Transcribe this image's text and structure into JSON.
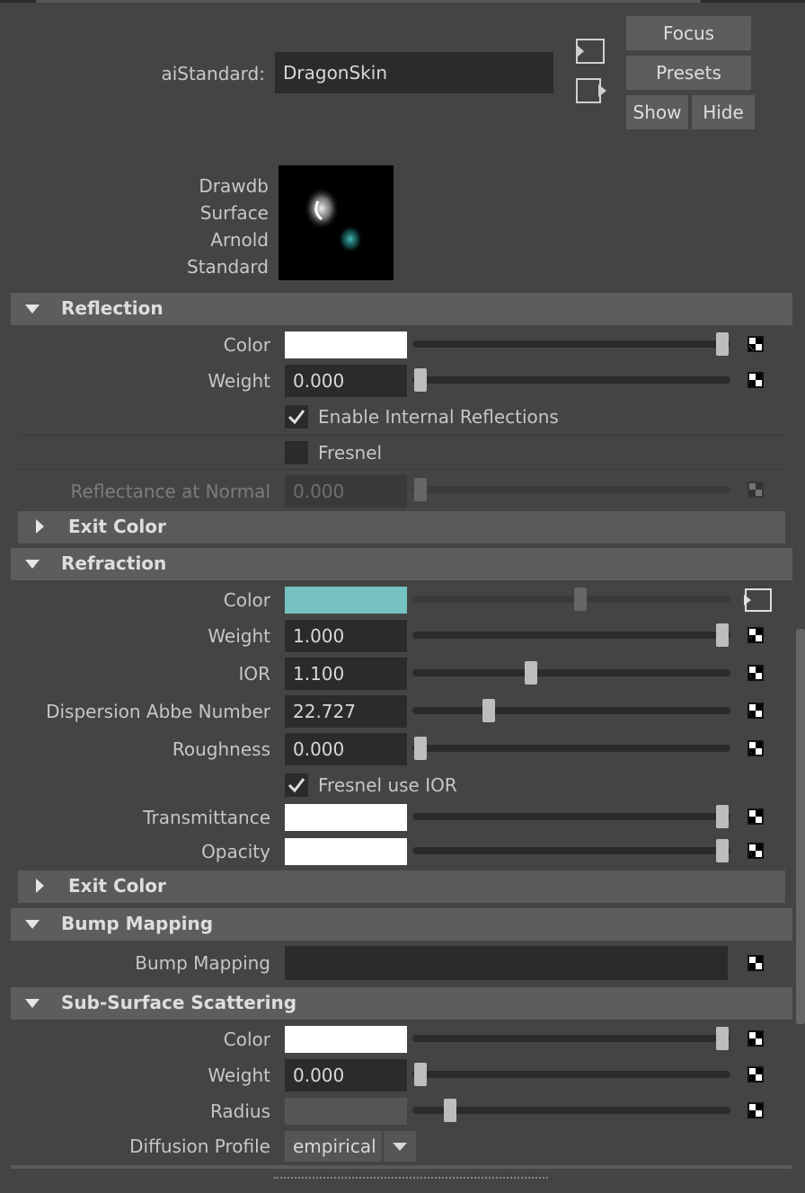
{
  "header": {
    "node_type_label": "aiStandard:",
    "node_name": "DragonSkin",
    "buttons": {
      "focus": "Focus",
      "presets": "Presets",
      "show": "Show",
      "hide": "Hide"
    },
    "swatch_label": [
      "Drawdb",
      "Surface",
      "Arnold",
      "Standard"
    ]
  },
  "reflection": {
    "title": "Reflection",
    "color_label": "Color",
    "weight_label": "Weight",
    "weight_value": "0.000",
    "enable_internal_label": "Enable Internal Reflections",
    "enable_internal_checked": true,
    "fresnel_label": "Fresnel",
    "fresnel_checked": false,
    "reflectance_label": "Reflectance at Normal",
    "reflectance_value": "0.000",
    "exit_color": "Exit Color"
  },
  "refraction": {
    "title": "Refraction",
    "color_label": "Color",
    "color_value": "#75c2c0",
    "weight_label": "Weight",
    "weight_value": "1.000",
    "ior_label": "IOR",
    "ior_value": "1.100",
    "abbe_label": "Dispersion Abbe Number",
    "abbe_value": "22.727",
    "roughness_label": "Roughness",
    "roughness_value": "0.000",
    "fresnel_ior_label": "Fresnel use IOR",
    "fresnel_ior_checked": true,
    "transmittance_label": "Transmittance",
    "opacity_label": "Opacity",
    "exit_color": "Exit Color"
  },
  "bump": {
    "title": "Bump Mapping",
    "label": "Bump Mapping"
  },
  "sss": {
    "title": "Sub-Surface Scattering",
    "color_label": "Color",
    "weight_label": "Weight",
    "weight_value": "0.000",
    "radius_label": "Radius",
    "diffusion_label": "Diffusion Profile",
    "diffusion_value": "empirical"
  },
  "icons": [
    "input-connection-icon",
    "output-connection-icon",
    "map-checker-icon",
    "checkmark-icon",
    "dropdown-arrow-icon",
    "collapse-triangle-icon",
    "expand-triangle-icon"
  ],
  "colors": {
    "background": "#444444",
    "section_header": "#5d5d5d",
    "field": "#2b2b2b",
    "refraction_color": "#75c2c0"
  }
}
